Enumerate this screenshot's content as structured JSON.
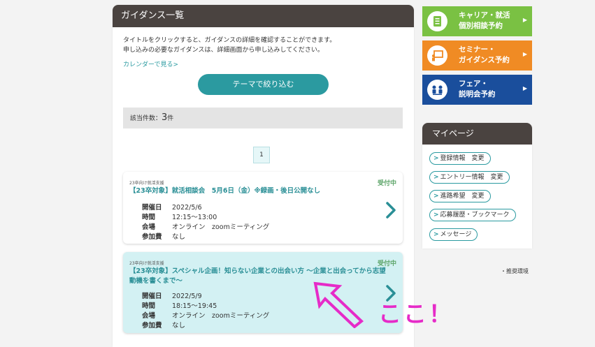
{
  "panel": {
    "title": "ガイダンス一覧"
  },
  "intro": {
    "line1": "タイトルをクリックすると、ガイダンスの詳細を確認することができます。",
    "line2": "申し込みの必要なガイダンスは、詳細画面から申し込みしてください。"
  },
  "calendar_link": "カレンダーで見る>",
  "theme_button": "テーマで絞り込む",
  "count": {
    "label": "該当件数：",
    "value": "3",
    "unit": "件"
  },
  "pagination": {
    "current": "1"
  },
  "cards": [
    {
      "category": "23卒向け就活支援",
      "status": "受付中",
      "title": "【23卒対象】就活相談会　5月6日（金）※録画・後日公開なし",
      "rows": [
        {
          "key": "開催日",
          "value": "2022/5/6"
        },
        {
          "key": "時間",
          "value": "12:15～13:00"
        },
        {
          "key": "会場",
          "value": "オンライン　zoomミーティング"
        },
        {
          "key": "参加費",
          "value": "なし"
        }
      ]
    },
    {
      "category": "23卒向け就活支援",
      "status": "受付中",
      "title": "【23卒対象】スペシャル企画！知らない企業との出会い方 ～企業と出会ってから志望動機を書くまで～",
      "rows": [
        {
          "key": "開催日",
          "value": "2022/5/9"
        },
        {
          "key": "時間",
          "value": "18:15～19:45"
        },
        {
          "key": "会場",
          "value": "オンライン　zoomミーティング"
        },
        {
          "key": "参加費",
          "value": "なし"
        }
      ]
    }
  ],
  "side_buttons": [
    {
      "line1": "キャリア・就活",
      "line2": "個別相談予約",
      "icon": "clipboard-icon",
      "color": "#7ac143"
    },
    {
      "line1": "セミナー・",
      "line2": "ガイダンス予約",
      "icon": "presentation-icon",
      "color": "#f08b24"
    },
    {
      "line1": "フェア・",
      "line2": "説明会予約",
      "icon": "people-meeting-icon",
      "color": "#1a4e9c"
    }
  ],
  "mypage": {
    "title": "マイページ",
    "items": [
      "登録情報　変更",
      "エントリー情報　変更",
      "進路希望　変更",
      "応募履歴・ブックマーク",
      "メッセージ"
    ]
  },
  "recommended_env": "・推奨環境",
  "annotation": {
    "text": "ここ！",
    "color": "#e62bc8"
  }
}
